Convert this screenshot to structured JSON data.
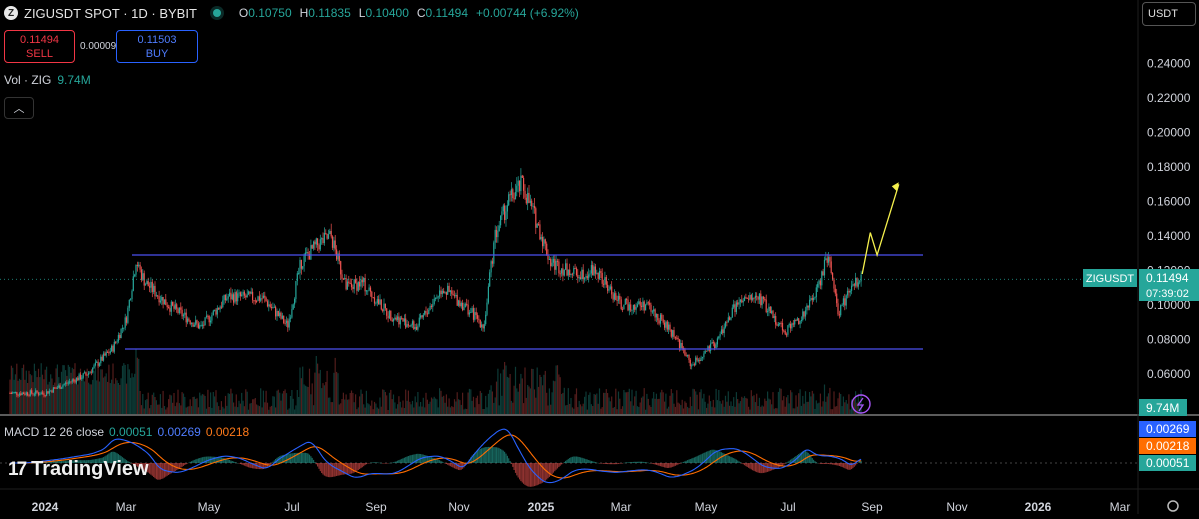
{
  "header": {
    "icon": "zig-logo-icon",
    "title": "ZIGUSDT SPOT · 1D · BYBIT",
    "open_label": "O",
    "open": "0.10750",
    "high_label": "H",
    "high": "0.11835",
    "low_label": "L",
    "low": "0.10400",
    "close_label": "C",
    "close": "0.11494",
    "change": "+0.00744 (+6.92%)"
  },
  "trade": {
    "sell_price": "0.11494",
    "sell_label": "SELL",
    "spread": "0.00009",
    "buy_price": "0.11503",
    "buy_label": "BUY"
  },
  "volume": {
    "label": "Vol · ZIG",
    "value": "9.74M"
  },
  "currency_button": "USDT",
  "macd": {
    "label": "MACD 12 26 close",
    "hist": "0.00051",
    "macd": "0.00269",
    "signal": "0.00218"
  },
  "logo": {
    "text": "TradingView"
  },
  "colors": {
    "up": "#26a69a",
    "down": "#ef5350",
    "channel": "#4b4ff0",
    "projection": "#f5f04d",
    "macd_line": "#2962ff",
    "signal_line": "#ff6d00",
    "background": "#000000"
  },
  "chart_data": {
    "type": "candlestick",
    "symbol": "ZIGUSDT",
    "exchange": "BYBIT",
    "interval": "1D",
    "y_ticks": [
      "0.24000",
      "0.22000",
      "0.20000",
      "0.18000",
      "0.16000",
      "0.14000",
      "0.12000",
      "0.10000",
      "0.08000",
      "0.06000"
    ],
    "x_ticks": [
      "2024",
      "Mar",
      "May",
      "Jul",
      "Sep",
      "Nov",
      "2025",
      "Mar",
      "May",
      "Jul",
      "Sep",
      "Nov",
      "2026",
      "Mar"
    ],
    "price_marker": {
      "label": "ZIGUSDT",
      "price": "0.11494",
      "countdown": "07:39:02"
    },
    "volume_marker": "9.74M",
    "macd_markers": [
      "0.00269",
      "0.00218",
      "0.00051"
    ],
    "channel": {
      "upper": 0.129,
      "lower": 0.0745,
      "start": "2024-03",
      "end": "2025-09"
    },
    "projection_path": [
      {
        "date": "2025-08-26",
        "price": 0.118
      },
      {
        "date": "2025-09-01",
        "price": 0.142
      },
      {
        "date": "2025-09-06",
        "price": 0.129
      },
      {
        "date": "2025-09-22",
        "price": 0.17
      }
    ],
    "price_path": [
      {
        "date": "2024-01-01",
        "price": 0.049
      },
      {
        "date": "2024-02-01",
        "price": 0.06
      },
      {
        "date": "2024-02-20",
        "price": 0.075
      },
      {
        "date": "2024-03-01",
        "price": 0.092
      },
      {
        "date": "2024-03-08",
        "price": 0.125
      },
      {
        "date": "2024-03-15",
        "price": 0.113
      },
      {
        "date": "2024-04-01",
        "price": 0.1
      },
      {
        "date": "2024-04-25",
        "price": 0.087
      },
      {
        "date": "2024-05-15",
        "price": 0.105
      },
      {
        "date": "2024-06-10",
        "price": 0.104
      },
      {
        "date": "2024-06-28",
        "price": 0.088
      },
      {
        "date": "2024-07-08",
        "price": 0.125
      },
      {
        "date": "2024-07-20",
        "price": 0.135
      },
      {
        "date": "2024-07-30",
        "price": 0.14
      },
      {
        "date": "2024-08-10",
        "price": 0.11
      },
      {
        "date": "2024-08-22",
        "price": 0.113
      },
      {
        "date": "2024-09-10",
        "price": 0.095
      },
      {
        "date": "2024-10-01",
        "price": 0.087
      },
      {
        "date": "2024-10-20",
        "price": 0.11
      },
      {
        "date": "2024-11-05",
        "price": 0.1
      },
      {
        "date": "2024-11-20",
        "price": 0.088
      },
      {
        "date": "2024-11-28",
        "price": 0.14
      },
      {
        "date": "2024-12-08",
        "price": 0.16
      },
      {
        "date": "2024-12-18",
        "price": 0.17
      },
      {
        "date": "2024-12-28",
        "price": 0.15
      },
      {
        "date": "2025-01-08",
        "price": 0.125
      },
      {
        "date": "2025-01-25",
        "price": 0.118
      },
      {
        "date": "2025-02-10",
        "price": 0.12
      },
      {
        "date": "2025-03-01",
        "price": 0.1
      },
      {
        "date": "2025-03-20",
        "price": 0.1
      },
      {
        "date": "2025-04-10",
        "price": 0.082
      },
      {
        "date": "2025-04-22",
        "price": 0.065
      },
      {
        "date": "2025-05-10",
        "price": 0.078
      },
      {
        "date": "2025-05-25",
        "price": 0.1
      },
      {
        "date": "2025-06-10",
        "price": 0.105
      },
      {
        "date": "2025-06-30",
        "price": 0.085
      },
      {
        "date": "2025-07-15",
        "price": 0.095
      },
      {
        "date": "2025-07-25",
        "price": 0.112
      },
      {
        "date": "2025-08-01",
        "price": 0.13
      },
      {
        "date": "2025-08-08",
        "price": 0.095
      },
      {
        "date": "2025-08-18",
        "price": 0.11
      },
      {
        "date": "2025-08-26",
        "price": 0.1149
      }
    ]
  }
}
